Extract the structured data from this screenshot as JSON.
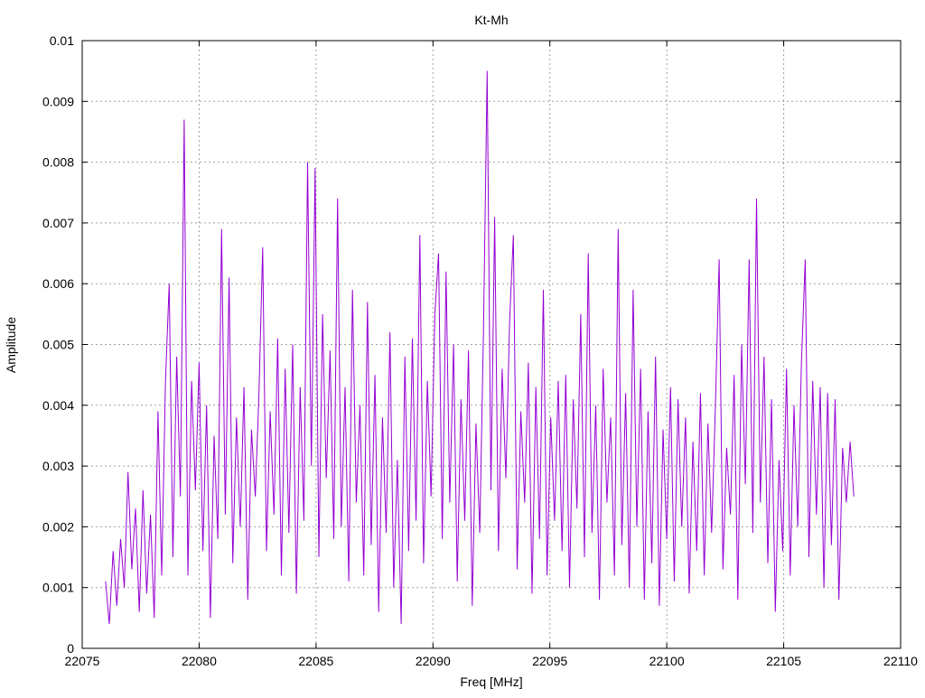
{
  "chart_data": {
    "type": "line",
    "title": "Kt-Mh",
    "xlabel": "Freq [MHz]",
    "ylabel": "Amplitude",
    "xlim": [
      22075,
      22110
    ],
    "ylim": [
      0,
      0.01
    ],
    "grid": true,
    "x_ticks": [
      "22075",
      "22080",
      "22085",
      "22090",
      "22095",
      "22100",
      "22105",
      "22110"
    ],
    "x_tick_values": [
      22075,
      22080,
      22085,
      22090,
      22095,
      22100,
      22105,
      22110
    ],
    "y_ticks": [
      "0",
      "0.001",
      "0.002",
      "0.003",
      "0.004",
      "0.005",
      "0.006",
      "0.007",
      "0.008",
      "0.009",
      "0.01"
    ],
    "y_tick_values": [
      0,
      0.001,
      0.002,
      0.003,
      0.004,
      0.005,
      0.006,
      0.007,
      0.008,
      0.009,
      0.01
    ],
    "series": [
      {
        "name": "Kt-Mh",
        "color": "#9400d3",
        "x_start": 22076,
        "x_step": 0.16,
        "values": [
          0.0011,
          0.0004,
          0.0016,
          0.0007,
          0.0018,
          0.001,
          0.0029,
          0.0013,
          0.0023,
          0.0006,
          0.0026,
          0.0009,
          0.0022,
          0.0005,
          0.0039,
          0.0012,
          0.0044,
          0.006,
          0.0015,
          0.0048,
          0.0025,
          0.0087,
          0.0012,
          0.0044,
          0.0026,
          0.0047,
          0.0016,
          0.004,
          0.0005,
          0.0035,
          0.0018,
          0.0069,
          0.0022,
          0.0061,
          0.0014,
          0.0038,
          0.002,
          0.0043,
          0.0008,
          0.0036,
          0.0025,
          0.0042,
          0.0066,
          0.0016,
          0.0039,
          0.0022,
          0.0051,
          0.0012,
          0.0046,
          0.0019,
          0.005,
          0.0009,
          0.0043,
          0.0021,
          0.008,
          0.003,
          0.0079,
          0.0015,
          0.0055,
          0.0028,
          0.0049,
          0.0018,
          0.0074,
          0.002,
          0.0043,
          0.0011,
          0.0059,
          0.0024,
          0.004,
          0.0012,
          0.0057,
          0.0017,
          0.0045,
          0.0006,
          0.0038,
          0.0019,
          0.0052,
          0.001,
          0.0031,
          0.0004,
          0.0048,
          0.0016,
          0.0051,
          0.0021,
          0.0068,
          0.0014,
          0.0044,
          0.0025,
          0.0055,
          0.0065,
          0.0018,
          0.0062,
          0.0024,
          0.005,
          0.0011,
          0.0041,
          0.0021,
          0.0049,
          0.0007,
          0.0037,
          0.0019,
          0.0052,
          0.0095,
          0.0026,
          0.0071,
          0.0016,
          0.0046,
          0.0028,
          0.0054,
          0.0068,
          0.0013,
          0.0039,
          0.0024,
          0.0047,
          0.0009,
          0.0043,
          0.0018,
          0.0059,
          0.0012,
          0.0038,
          0.0021,
          0.0044,
          0.0016,
          0.0045,
          0.001,
          0.0041,
          0.0023,
          0.0055,
          0.0015,
          0.0065,
          0.0019,
          0.004,
          0.0008,
          0.0046,
          0.0024,
          0.0038,
          0.0012,
          0.0069,
          0.0017,
          0.0042,
          0.001,
          0.0059,
          0.002,
          0.0046,
          0.0008,
          0.0039,
          0.0014,
          0.0048,
          0.0007,
          0.0036,
          0.0018,
          0.0043,
          0.0011,
          0.0041,
          0.002,
          0.0038,
          0.0009,
          0.0034,
          0.0016,
          0.0042,
          0.0012,
          0.0037,
          0.0019,
          0.004,
          0.0064,
          0.0013,
          0.0033,
          0.0022,
          0.0045,
          0.0008,
          0.005,
          0.0027,
          0.0064,
          0.0019,
          0.0074,
          0.0024,
          0.0048,
          0.0014,
          0.0041,
          0.0006,
          0.0031,
          0.0016,
          0.0046,
          0.0012,
          0.004,
          0.002,
          0.0047,
          0.0064,
          0.0015,
          0.0044,
          0.0022,
          0.0043,
          0.001,
          0.0042,
          0.0017,
          0.0041,
          0.0008,
          0.0033,
          0.0024,
          0.0034,
          0.0025
        ]
      }
    ]
  }
}
